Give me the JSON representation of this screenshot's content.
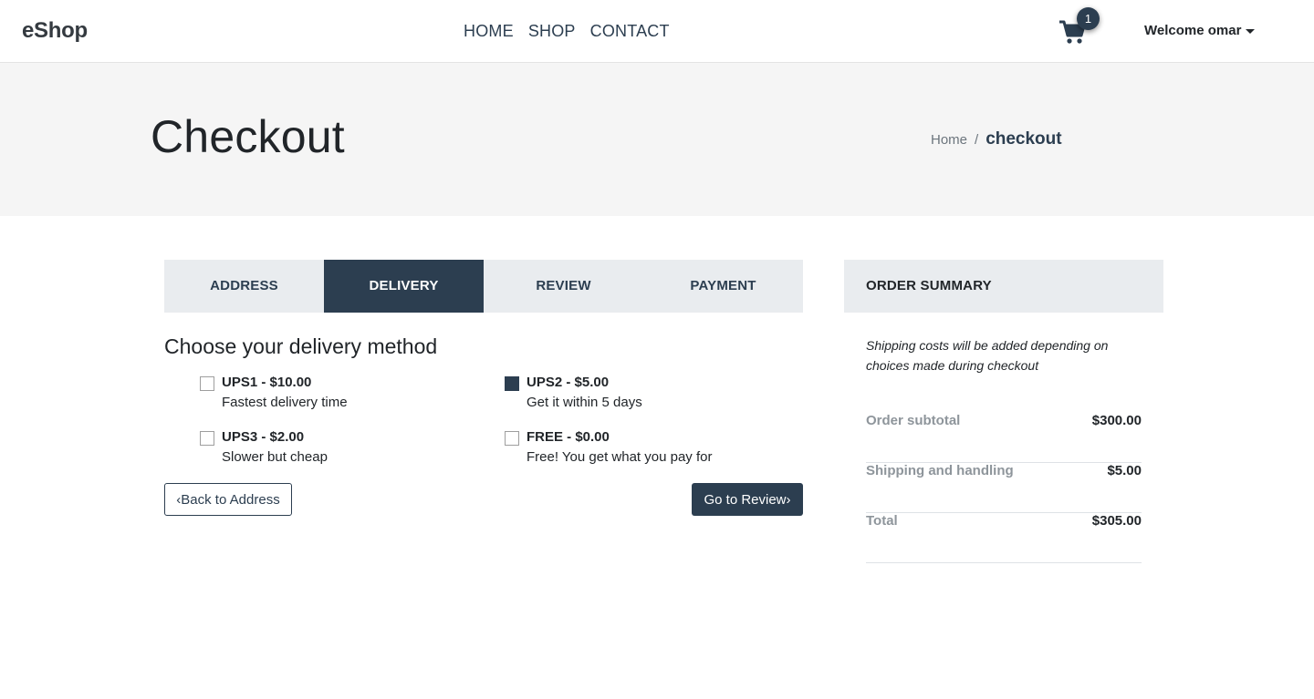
{
  "navbar": {
    "brand": "eShop",
    "links": [
      "HOME",
      "SHOP",
      "CONTACT"
    ],
    "cart_count": "1",
    "user_menu_label": "Welcome omar"
  },
  "header": {
    "title": "Checkout",
    "breadcrumb": {
      "home": "Home",
      "separator": "/",
      "current": "checkout"
    }
  },
  "steps": [
    {
      "label": "ADDRESS",
      "active": false
    },
    {
      "label": "DELIVERY",
      "active": true
    },
    {
      "label": "REVIEW",
      "active": false
    },
    {
      "label": "PAYMENT",
      "active": false
    }
  ],
  "delivery": {
    "title": "Choose your delivery method",
    "options": [
      {
        "title": "UPS1 - $10.00",
        "description": "Fastest delivery time",
        "selected": false
      },
      {
        "title": "UPS2 - $5.00",
        "description": "Get it within 5 days",
        "selected": true
      },
      {
        "title": "UPS3 - $2.00",
        "description": "Slower but cheap",
        "selected": false
      },
      {
        "title": "FREE - $0.00",
        "description": "Free! You get what you pay for",
        "selected": false
      }
    ],
    "back_label": "Back to Address",
    "next_label": "Go to Review"
  },
  "summary": {
    "title": "ORDER SUMMARY",
    "note": "Shipping costs will be added depending on choices made during checkout",
    "rows": [
      {
        "label": "Order subtotal",
        "value": "$300.00"
      },
      {
        "label": "Shipping and handling",
        "value": "$5.00"
      },
      {
        "label": "Total",
        "value": "$305.00"
      }
    ]
  },
  "colors": {
    "primary": "#2c3e50",
    "band": "#f5f5f5",
    "panel": "#e9ecef"
  }
}
